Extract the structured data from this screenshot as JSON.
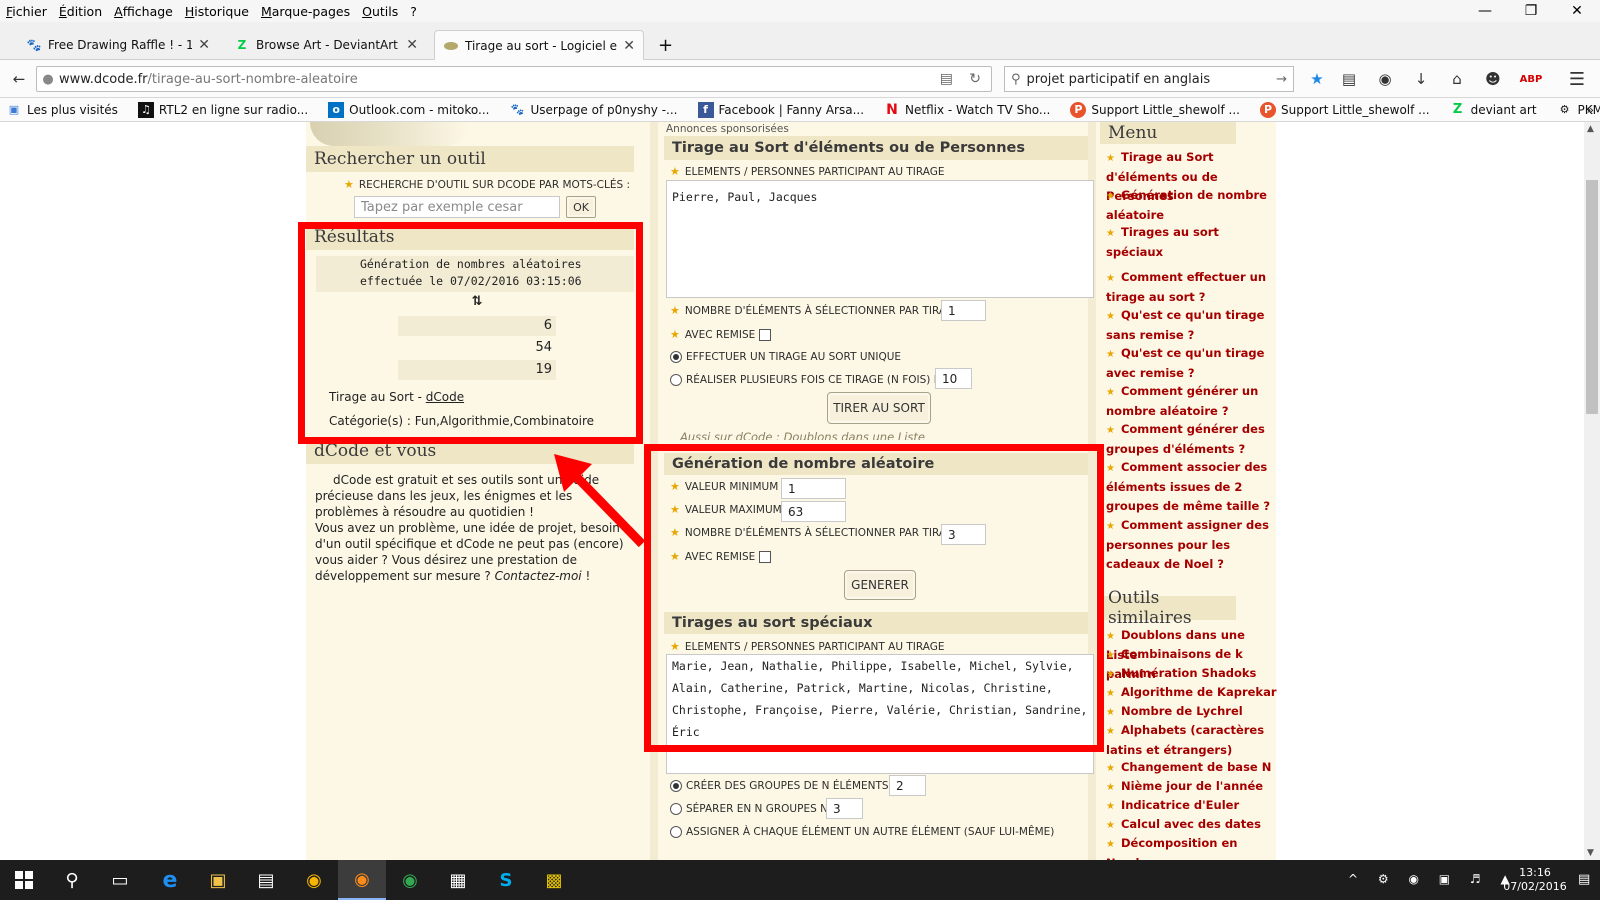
{
  "menubar": {
    "items": [
      "Fichier",
      "Édition",
      "Affichage",
      "Historique",
      "Marque-pages",
      "Outils",
      "?"
    ]
  },
  "tabs": [
    {
      "label": "Free Drawing Raffle ! - 100..."
    },
    {
      "label": "Browse Art - DeviantArt"
    },
    {
      "label": "Tirage au sort - Logiciel e..."
    }
  ],
  "nav": {
    "url_domain": "www.dcode.fr",
    "url_path": "/tirage-au-sort-nombre-aleatoire",
    "search_value": "projet participatif en anglais"
  },
  "bookmarks": [
    {
      "label": "Les plus visités"
    },
    {
      "label": "RTL2 en ligne sur radio..."
    },
    {
      "label": "Outlook.com - mitoko..."
    },
    {
      "label": "Userpage of p0nyshy -..."
    },
    {
      "label": "Facebook | Fanny Arsa..."
    },
    {
      "label": "Netflix - Watch TV Sho..."
    },
    {
      "label": "Support Little_shewolf ..."
    },
    {
      "label": "Support Little_shewolf ..."
    },
    {
      "label": "deviant art"
    },
    {
      "label": "PKMN M.D ∞ Explorer..."
    }
  ],
  "left": {
    "search_title": "Rechercher un outil",
    "search_label": "RECHERCHE D'OUTIL SUR DCODE PAR MOTS-CLÉS :",
    "search_placeholder": "Tapez par exemple cesar",
    "ok": "OK",
    "results_title": "Résultats",
    "results_line1": "Génération de nombres aléatoires",
    "results_line2": "effectuée le 07/02/2016 03:15:06",
    "sort_glyph": "⇅",
    "numbers": [
      "6",
      "54",
      "19"
    ],
    "tirage_prefix": "Tirage au Sort - ",
    "tirage_link": "dCode",
    "categories": "Catégorie(s) : Fun,Algorithmie,Combinatoire",
    "about_title": "dCode et vous",
    "about_p1": "dCode est gratuit et ses outils sont une aide précieuse dans les jeux, les énigmes et les problèmes à résoudre au quotidien !",
    "about_p2": "Vous avez un problème, une idée de projet, besoin d'un outil spécifique et dCode ne peut pas (encore) vous aider ? Vous désirez une prestation de développement sur mesure ?",
    "about_contact": "Contactez-moi",
    "about_end": " !"
  },
  "center": {
    "sponsored": "Annonces sponsorisées",
    "s1_title": "Tirage au Sort d'éléments ou de Personnes",
    "s1_label_elements": "ELEMENTS / PERSONNES PARTICIPANT AU TIRAGE",
    "s1_textarea": "Pierre, Paul, Jacques",
    "s1_label_nb": "NOMBRE D'ÉLÉMENTS À SÉLECTIONNER PAR TIRAGE",
    "s1_nb": "1",
    "s1_label_remise": "AVEC REMISE",
    "s1_radio1": "EFFECTUER UN TIRAGE AU SORT UNIQUE",
    "s1_radio2": "RÉALISER PLUSIEURS FOIS CE TIRAGE (N FOIS) N=",
    "s1_n": "10",
    "s1_button": "TIRER AU SORT",
    "see_also": "Aussi sur dCode : Doublons dans une Liste",
    "s2_title": "Génération de nombre aléatoire",
    "s2_label_min": "VALEUR MINIMUM",
    "s2_min": "1",
    "s2_label_max": "VALEUR MAXIMUM",
    "s2_max": "63",
    "s2_label_nb": "NOMBRE D'ÉLÉMENTS À SÉLECTIONNER PAR TIRAGE",
    "s2_nb": "3",
    "s2_label_remise": "AVEC REMISE",
    "s2_button": "GENERER",
    "s3_title": "Tirages au sort spéciaux",
    "s3_label_elements": "ELEMENTS / PERSONNES PARTICIPANT AU TIRAGE",
    "s3_textarea": "Marie, Jean, Nathalie, Philippe, Isabelle, Michel, Sylvie, Alain, Catherine, Patrick, Martine, Nicolas, Christine, Christophe, Françoise, Pierre, Valérie, Christian, Sandrine, Éric",
    "s3_radio1": "CRÉER DES GROUPES DE N ÉLÉMENTS N=",
    "s3_n1": "2",
    "s3_radio2": "SÉPARER EN N GROUPES N=",
    "s3_n2": "3",
    "s3_radio3": "ASSIGNER À CHAQUE ÉLÉMENT UN AUTRE ÉLÉMENT (SAUF LUI-MÊME)"
  },
  "right": {
    "menu_title": "Menu",
    "menu_links": [
      "Tirage au Sort d'éléments ou de Personnes",
      "Génération de nombre aléatoire",
      "Tirages au sort spéciaux"
    ],
    "faq_links": [
      "Comment effectuer un tirage au sort ?",
      "Qu'est ce qu'un tirage sans remise ?",
      "Qu'est ce qu'un tirage avec remise ?",
      "Comment générer un nombre aléatoire ?",
      "Comment générer des groupes d'éléments ?",
      "Comment associer des éléments issues de 2 groupes de même taille ?",
      "Comment assigner des personnes pour les cadeaux de Noel ?"
    ],
    "similar_title": "Outils similaires",
    "similar_links": [
      "Doublons dans une Liste",
      "Combinaisons de k parmi n",
      "Numération Shadoks",
      "Algorithme de Kaprekar",
      "Nombre de Lychrel",
      "Alphabets (caractères latins et étrangers)",
      "Changement de base N",
      "Nième jour de l'année",
      "Indicatrice d'Euler",
      "Calcul avec des dates",
      "Décomposition en Nombres"
    ]
  },
  "taskbar": {
    "time": "13:16",
    "date": "07/02/2016"
  },
  "colors": {
    "highlight": "#ff0000",
    "link": "#a50000",
    "panel": "#fdf8e6",
    "heading": "#efe6c6"
  }
}
